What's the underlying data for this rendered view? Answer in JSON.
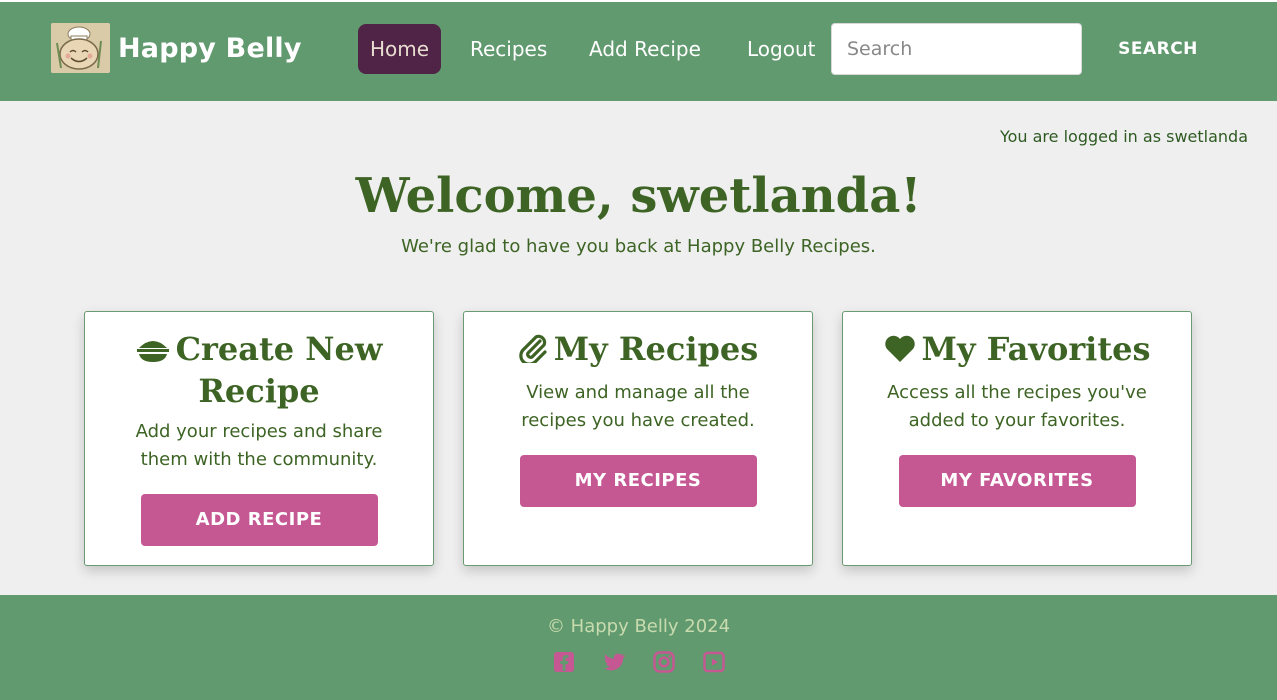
{
  "navbar": {
    "brand": "Happy Belly",
    "links": [
      {
        "label": "Home",
        "active": true
      },
      {
        "label": "Recipes",
        "active": false
      },
      {
        "label": "Add Recipe",
        "active": false
      },
      {
        "label": "Logout",
        "active": false
      }
    ],
    "search": {
      "placeholder": "Search",
      "value": "",
      "button": "SEARCH"
    }
  },
  "status": {
    "logged_in": "You are logged in as swetlanda"
  },
  "welcome": {
    "title": "Welcome, swetlanda!",
    "subtitle": "We're glad to have you back at Happy Belly Recipes."
  },
  "cards": [
    {
      "icon": "bowl-icon",
      "title": "Create New Recipe",
      "text": "Add your recipes and share them with the community.",
      "button": "ADD RECIPE"
    },
    {
      "icon": "paperclip-icon",
      "title": "My Recipes",
      "text": "View and manage all the recipes you have created.",
      "button": "MY RECIPES"
    },
    {
      "icon": "heart-icon",
      "title": "My Favorites",
      "text": "Access all the recipes you've added to your favorites.",
      "button": "MY FAVORITES"
    }
  ],
  "footer": {
    "copyright": "© Happy Belly 2024",
    "social": [
      "facebook-icon",
      "twitter-icon",
      "instagram-icon",
      "youtube-icon"
    ]
  },
  "colors": {
    "nav_bg": "#629a70",
    "active_bg": "#4f2446",
    "accent_pink": "#c55793",
    "heading_green": "#3d6424",
    "footer_text": "#c8dbae"
  }
}
